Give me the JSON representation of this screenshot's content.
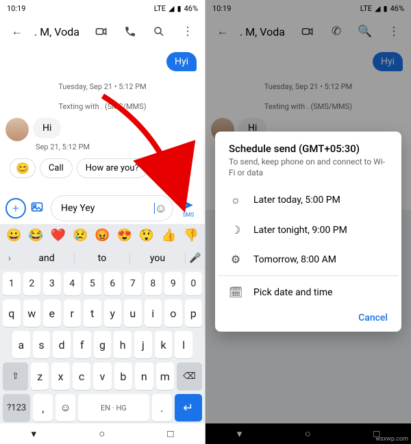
{
  "status": {
    "time": "10:19",
    "net": "LTE",
    "batt": "46%"
  },
  "header": {
    "title": ". M, Voda"
  },
  "messages": {
    "out1": "Hyi",
    "meta_time": "Tuesday, Sep 21 • 5:12 PM",
    "meta_mode": "Texting with . (SMS/MMS)",
    "in1": "Hi",
    "in1_time": "Sep 21, 5:12 PM"
  },
  "suggestions": {
    "emoji": "😊",
    "s1": "Call",
    "s2": "How are you?",
    "s3": "ool"
  },
  "composer": {
    "text": "Hey Yey",
    "send": "SMS"
  },
  "kbd": {
    "emojis": [
      "😀",
      "😂",
      "❤️",
      "😢",
      "😡",
      "😍",
      "😲",
      "👍",
      "👎"
    ],
    "sugg": [
      "and",
      "to",
      "you"
    ],
    "row_num": [
      "1",
      "2",
      "3",
      "4",
      "5",
      "6",
      "7",
      "8",
      "9",
      "0"
    ],
    "row1": [
      "q",
      "w",
      "e",
      "r",
      "t",
      "y",
      "u",
      "i",
      "o",
      "p"
    ],
    "row2": [
      "a",
      "s",
      "d",
      "f",
      "g",
      "h",
      "j",
      "k",
      "l"
    ],
    "row3": [
      "z",
      "x",
      "c",
      "v",
      "b",
      "n",
      "m"
    ],
    "shift": "⇧",
    "bksp": "⌫",
    "sym": "?123",
    "comma": ",",
    "smile": "☺",
    "space": "EN · HG",
    "dot": ".",
    "enter": "↵"
  },
  "dialog": {
    "title": "Schedule send (GMT+05:30)",
    "sub": "To send, keep phone on and connect to Wi-Fi or data",
    "opt1": "Later today, 5:00 PM",
    "opt2": "Later tonight, 9:00 PM",
    "opt3": "Tomorrow, 8:00 AM",
    "opt4": "Pick date and time",
    "cancel": "Cancel"
  },
  "watermark": "wsxwp.com"
}
